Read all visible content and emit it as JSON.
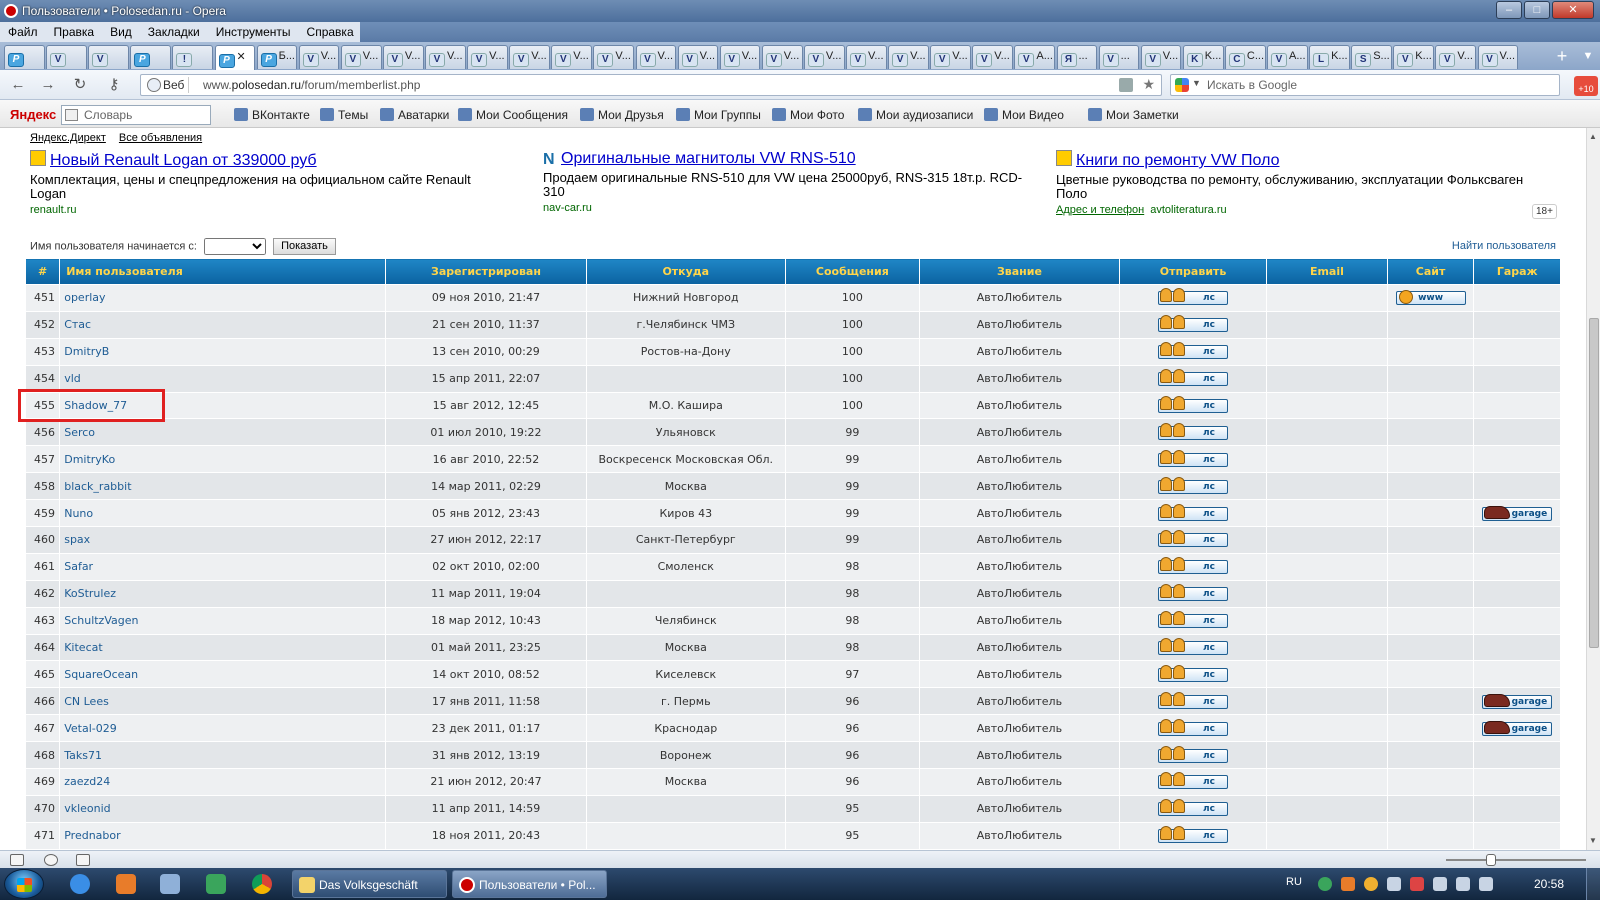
{
  "window": {
    "title": "Пользователи • Polosedan.ru - Opera",
    "buttons": {
      "minimize": "–",
      "maximize": "□",
      "close": "✕"
    }
  },
  "menu": [
    "Файл",
    "Правка",
    "Вид",
    "Закладки",
    "Инструменты",
    "Справка"
  ],
  "tabs": [
    {
      "icon": "P",
      "label": ""
    },
    {
      "icon": "V",
      "label": ""
    },
    {
      "icon": "V",
      "label": ""
    },
    {
      "icon": "P",
      "label": ""
    },
    {
      "icon": "!",
      "label": ""
    },
    {
      "icon": "P",
      "label": "",
      "close": "✕",
      "active": true
    },
    {
      "icon": "P",
      "label": "Б..."
    },
    {
      "icon": "V",
      "label": "V..."
    },
    {
      "icon": "V",
      "label": "V..."
    },
    {
      "icon": "V",
      "label": "V..."
    },
    {
      "icon": "V",
      "label": "V..."
    },
    {
      "icon": "V",
      "label": "V..."
    },
    {
      "icon": "V",
      "label": "V..."
    },
    {
      "icon": "V",
      "label": "V..."
    },
    {
      "icon": "V",
      "label": "V..."
    },
    {
      "icon": "V",
      "label": "V..."
    },
    {
      "icon": "V",
      "label": "V..."
    },
    {
      "icon": "V",
      "label": "V..."
    },
    {
      "icon": "V",
      "label": "V..."
    },
    {
      "icon": "V",
      "label": "V..."
    },
    {
      "icon": "V",
      "label": "V..."
    },
    {
      "icon": "V",
      "label": "V..."
    },
    {
      "icon": "V",
      "label": "V..."
    },
    {
      "icon": "V",
      "label": "V..."
    },
    {
      "icon": "V",
      "label": "A..."
    },
    {
      "icon": "Я",
      "label": "..."
    },
    {
      "icon": "V",
      "label": "..."
    },
    {
      "icon": "V",
      "label": "V..."
    },
    {
      "icon": "K",
      "label": "K..."
    },
    {
      "icon": "C",
      "label": "C..."
    },
    {
      "icon": "V",
      "label": "A..."
    },
    {
      "icon": "L",
      "label": "K..."
    },
    {
      "icon": "S",
      "label": "S..."
    },
    {
      "icon": "V",
      "label": "K..."
    },
    {
      "icon": "V",
      "label": "V..."
    },
    {
      "icon": "V",
      "label": "V..."
    }
  ],
  "tab_new": "+",
  "address": {
    "web_label": "Веб",
    "url_prefix": "www.",
    "url_domain": "polosedan.ru",
    "url_path": "/forum/memberlist.php",
    "search_placeholder": "Искать в Google",
    "mail_badge": "+10"
  },
  "yandex_bar": {
    "logo": "Яндекс",
    "search_placeholder": "Словарь",
    "items": [
      "ВКонтакте",
      "Темы",
      "Аватарки",
      "Мои Сообщения",
      "Мои Друзья",
      "Мои Группы",
      "Мои Фото",
      "Мои аудиозаписи",
      "Мои Видео",
      "Мои Заметки"
    ]
  },
  "direct": {
    "yandex_direct": "Яндекс.Директ",
    "all_ads": "Все объявления"
  },
  "ads": [
    {
      "title": "Новый Renault Logan от 339000 руб",
      "text": "Комплектация, цены и спецпредложения на официальном сайте Renault Logan",
      "source": "renault.ru",
      "address_link": ""
    },
    {
      "title": "Оригинальные магнитолы VW RNS-510",
      "text": "Продаем оригинальные RNS-510 для VW цена 25000руб, RNS-315 18т.р. RCD-310",
      "source": "nav-car.ru",
      "address_link": ""
    },
    {
      "title": "Книги по ремонту VW Поло",
      "text": "Цветные руководства по ремонту, обслуживанию, эксплуатации Фольксваген Поло",
      "source": "avtoliteratura.ru",
      "address_link": "Адрес и телефон"
    }
  ],
  "age_badge": "18+",
  "filter": {
    "label": "Имя пользователя начинается с:",
    "show_button": "Показать",
    "find_users": "Найти пользователя"
  },
  "table": {
    "headers": [
      "#",
      "Имя пользователя",
      "Зарегистрирован",
      "Откуда",
      "Сообщения",
      "Звание",
      "Отправить",
      "Email",
      "Сайт",
      "Гараж"
    ],
    "pm_label": "лс",
    "www_label": "www",
    "garage_label": "garage",
    "rows": [
      {
        "n": "451",
        "name": "operlay",
        "reg": "09 ноя 2010, 21:47",
        "from": "Нижний Новгород",
        "posts": "100",
        "rank": "АвтоЛюбитель",
        "www": true,
        "garage": false
      },
      {
        "n": "452",
        "name": "Стас",
        "reg": "21 сен 2010, 11:37",
        "from": "г.Челябинск ЧМЗ",
        "posts": "100",
        "rank": "АвтоЛюбитель",
        "www": false,
        "garage": false
      },
      {
        "n": "453",
        "name": "DmitryB",
        "reg": "13 сен 2010, 00:29",
        "from": "Ростов-на-Дону",
        "posts": "100",
        "rank": "АвтоЛюбитель",
        "www": false,
        "garage": false
      },
      {
        "n": "454",
        "name": "vld",
        "reg": "15 апр 2011, 22:07",
        "from": "",
        "posts": "100",
        "rank": "АвтоЛюбитель",
        "www": false,
        "garage": false
      },
      {
        "n": "455",
        "name": "Shadow_77",
        "reg": "15 авг 2012, 12:45",
        "from": "М.О. Кашира",
        "posts": "100",
        "rank": "АвтоЛюбитель",
        "www": false,
        "garage": false
      },
      {
        "n": "456",
        "name": "Serco",
        "reg": "01 июл 2010, 19:22",
        "from": "Ульяновск",
        "posts": "99",
        "rank": "АвтоЛюбитель",
        "www": false,
        "garage": false
      },
      {
        "n": "457",
        "name": "DmitryKo",
        "reg": "16 авг 2010, 22:52",
        "from": "Воскресенск Московская Обл.",
        "posts": "99",
        "rank": "АвтоЛюбитель",
        "www": false,
        "garage": false
      },
      {
        "n": "458",
        "name": "black_rabbit",
        "reg": "14 мар 2011, 02:29",
        "from": "Москва",
        "posts": "99",
        "rank": "АвтоЛюбитель",
        "www": false,
        "garage": false
      },
      {
        "n": "459",
        "name": "Nuno",
        "reg": "05 янв 2012, 23:43",
        "from": "Киров 43",
        "posts": "99",
        "rank": "АвтоЛюбитель",
        "www": false,
        "garage": true
      },
      {
        "n": "460",
        "name": "spax",
        "reg": "27 июн 2012, 22:17",
        "from": "Санкт-Петербург",
        "posts": "99",
        "rank": "АвтоЛюбитель",
        "www": false,
        "garage": false
      },
      {
        "n": "461",
        "name": "Safar",
        "reg": "02 окт 2010, 02:00",
        "from": "Смоленск",
        "posts": "98",
        "rank": "АвтоЛюбитель",
        "www": false,
        "garage": false
      },
      {
        "n": "462",
        "name": "KoStrulez",
        "reg": "11 мар 2011, 19:04",
        "from": "",
        "posts": "98",
        "rank": "АвтоЛюбитель",
        "www": false,
        "garage": false
      },
      {
        "n": "463",
        "name": "SchultzVagen",
        "reg": "18 мар 2012, 10:43",
        "from": "Челябинск",
        "posts": "98",
        "rank": "АвтоЛюбитель",
        "www": false,
        "garage": false
      },
      {
        "n": "464",
        "name": "Kitecat",
        "reg": "01 май 2011, 23:25",
        "from": "Москва",
        "posts": "98",
        "rank": "АвтоЛюбитель",
        "www": false,
        "garage": false
      },
      {
        "n": "465",
        "name": "SquareOcean",
        "reg": "14 окт 2010, 08:52",
        "from": "Киселевск",
        "posts": "97",
        "rank": "АвтоЛюбитель",
        "www": false,
        "garage": false
      },
      {
        "n": "466",
        "name": "CN Lees",
        "reg": "17 янв 2011, 11:58",
        "from": "г. Пермь",
        "posts": "96",
        "rank": "АвтоЛюбитель",
        "www": false,
        "garage": true
      },
      {
        "n": "467",
        "name": "Vetal-029",
        "reg": "23 дек 2011, 01:17",
        "from": "Краснодар",
        "posts": "96",
        "rank": "АвтоЛюбитель",
        "www": false,
        "garage": true
      },
      {
        "n": "468",
        "name": "Taks71",
        "reg": "31 янв 2012, 13:19",
        "from": "Воронеж",
        "posts": "96",
        "rank": "АвтоЛюбитель",
        "www": false,
        "garage": false
      },
      {
        "n": "469",
        "name": "zaezd24",
        "reg": "21 июн 2012, 20:47",
        "from": "Москва",
        "posts": "96",
        "rank": "АвтоЛюбитель",
        "www": false,
        "garage": false
      },
      {
        "n": "470",
        "name": "vkleonid",
        "reg": "11 апр 2011, 14:59",
        "from": "",
        "posts": "95",
        "rank": "АвтоЛюбитель",
        "www": false,
        "garage": false
      },
      {
        "n": "471",
        "name": "Prednabor",
        "reg": "18 ноя 2011, 20:43",
        "from": "",
        "posts": "95",
        "rank": "АвтоЛюбитель",
        "www": false,
        "garage": false
      }
    ]
  },
  "taskbar": {
    "tasks": [
      {
        "label": "Das Volksgeschäft",
        "active": false
      },
      {
        "label": "Пользователи • Pol...",
        "active": true
      }
    ],
    "lang": "RU",
    "clock": "20:58"
  }
}
